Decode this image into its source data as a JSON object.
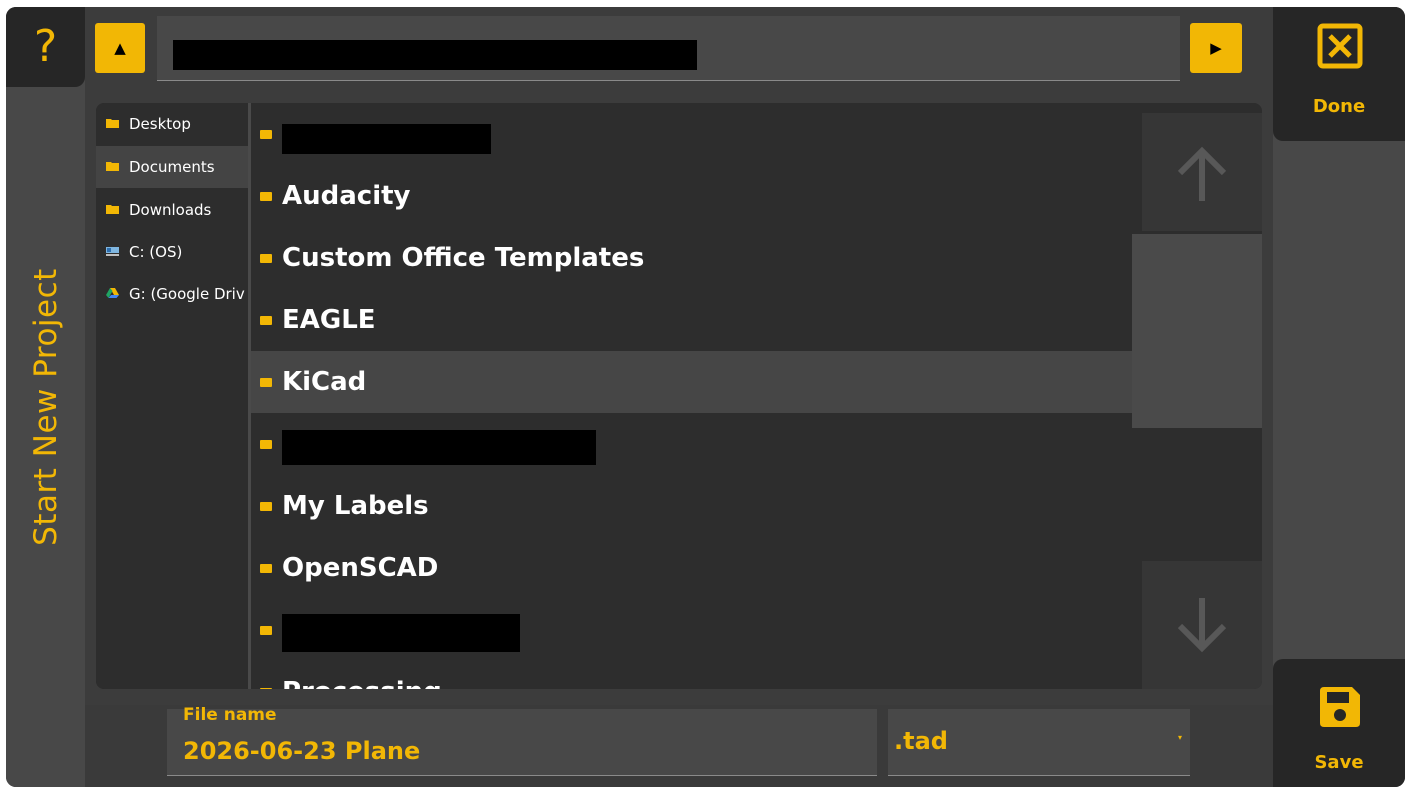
{
  "window": {
    "title": "Start New Project",
    "help_label": "?"
  },
  "toolbar": {
    "up_label": "▲",
    "forward_label": "▶",
    "path_value": ""
  },
  "actions": {
    "done_label": "Done",
    "save_label": "Save"
  },
  "places": [
    {
      "label": "Desktop",
      "icon": "folder-icon",
      "selected": false
    },
    {
      "label": "Documents",
      "icon": "folder-icon",
      "selected": true
    },
    {
      "label": "Downloads",
      "icon": "folder-icon",
      "selected": false
    },
    {
      "label": "C: (OS)",
      "icon": "drive-icon",
      "selected": false
    },
    {
      "label": "G: (Google Driv",
      "icon": "google-drive-icon",
      "selected": false
    }
  ],
  "folders": [
    {
      "label": "",
      "redacted": true
    },
    {
      "label": "Audacity"
    },
    {
      "label": "Custom Office Templates"
    },
    {
      "label": "EAGLE"
    },
    {
      "label": "KiCad",
      "selected": true
    },
    {
      "label": "",
      "redacted": true
    },
    {
      "label": "My Labels"
    },
    {
      "label": "OpenSCAD"
    },
    {
      "label": "",
      "redacted": true
    },
    {
      "label": "Processing"
    }
  ],
  "file": {
    "caption": "File name",
    "name": "2026-06-23 Plane",
    "extension": ".tad"
  },
  "colors": {
    "accent": "#f2b705",
    "background": "#3c3c3c",
    "panel": "#2d2d2d",
    "selected_row": "#464646"
  }
}
